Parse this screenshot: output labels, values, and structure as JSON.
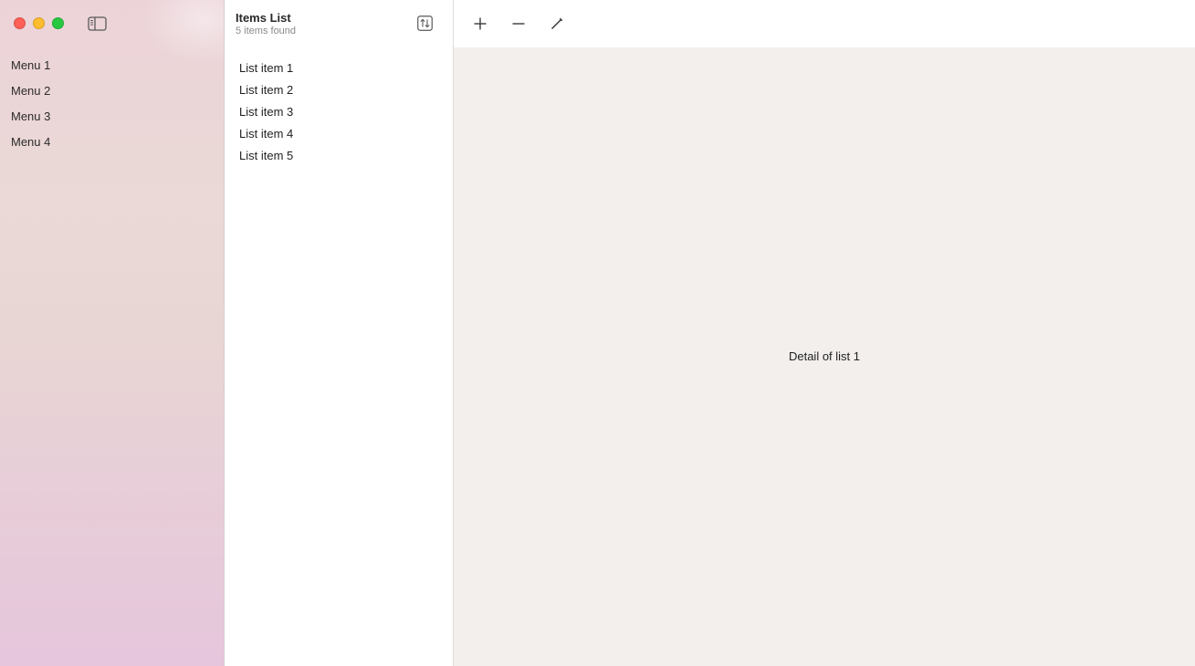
{
  "window": {
    "controls": [
      "close",
      "minimize",
      "zoom"
    ],
    "icons": {
      "sidebar_toggle": "sidebar-toggle-icon",
      "sort": "sort-arrows-icon",
      "add": "plus-icon",
      "remove": "minus-icon",
      "edit": "pencil-icon"
    },
    "colors": {
      "close": "#ff5f57",
      "minimize": "#febc2e",
      "zoom": "#28c840",
      "detail_bg": "#f2efed"
    }
  },
  "sidebar": {
    "items": [
      {
        "label": "Menu 1"
      },
      {
        "label": "Menu 2"
      },
      {
        "label": "Menu 3"
      },
      {
        "label": "Menu 4"
      }
    ]
  },
  "list": {
    "title": "Items List",
    "subtitle": "5 items found",
    "items": [
      {
        "label": "List item 1"
      },
      {
        "label": "List item 2"
      },
      {
        "label": "List item 3"
      },
      {
        "label": "List item 4"
      },
      {
        "label": "List item 5"
      }
    ]
  },
  "detail": {
    "text": "Detail of list 1"
  }
}
